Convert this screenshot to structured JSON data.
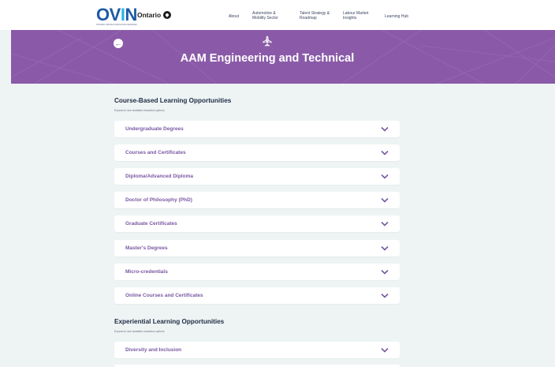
{
  "header": {
    "logo_text": "OVIN",
    "logo_subtext": "ONTARIO VEHICLE INNOVATION NETWORK",
    "ontario_text": "Ontario",
    "nav": [
      {
        "label": "About"
      },
      {
        "label": "Automotive & Mobility Sector"
      },
      {
        "label": "Talent Strategy & Roadmap"
      },
      {
        "label": "Labour Market Insights"
      },
      {
        "label": "Learning Hub"
      }
    ]
  },
  "hero": {
    "title": "AAM Engineering and Technical",
    "back_icon": "arrow-left-icon",
    "category_icon": "aircraft-icon",
    "color": "#8a5aa8"
  },
  "course_section": {
    "title": "Course-Based Learning Opportunities",
    "subtitle": "Expand to see available education options",
    "items": [
      {
        "label": "Undergraduate Degrees"
      },
      {
        "label": "Courses and Certificates"
      },
      {
        "label": "Diploma/Advanced Diploma"
      },
      {
        "label": "Doctor of Philosophy (PhD)"
      },
      {
        "label": "Graduate Certificates"
      },
      {
        "label": "Master's Degrees"
      },
      {
        "label": "Micro-credentials"
      },
      {
        "label": "Online Courses and Certificates"
      }
    ]
  },
  "experiential_section": {
    "title": "Experiential Learning Opportunities",
    "subtitle": "Expand to see available education options",
    "items": [
      {
        "label": "Diversity and Inclusion"
      }
    ]
  },
  "colors": {
    "accent_purple": "#7a58a4",
    "background": "#eef4f4",
    "chevron": "#7a58a4"
  }
}
